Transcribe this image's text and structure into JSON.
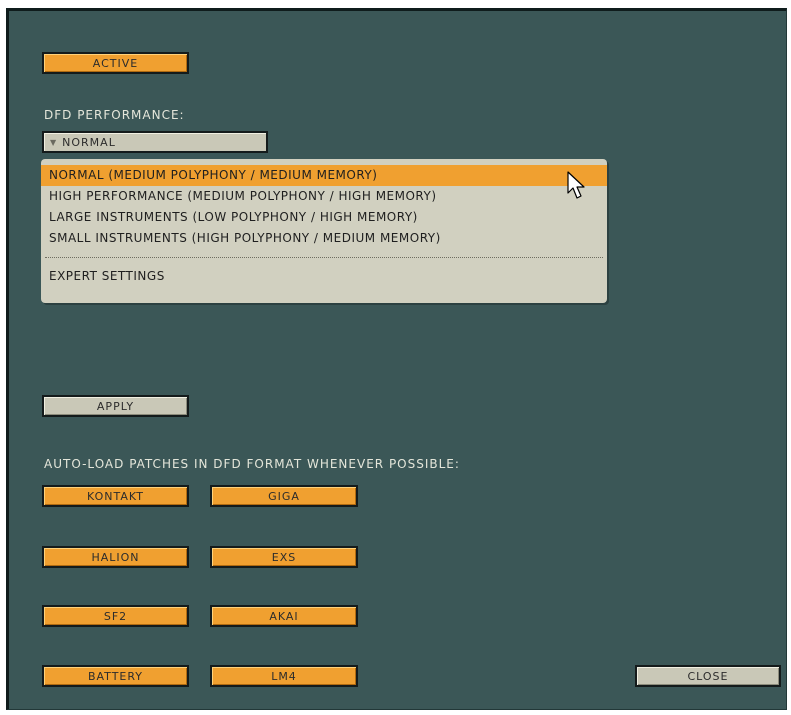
{
  "active_button": "ACTIVE",
  "dfd_performance": {
    "label": "DFD PERFORMANCE:",
    "selected": "NORMAL",
    "options": [
      "NORMAL (MEDIUM POLYPHONY / MEDIUM MEMORY)",
      "HIGH PERFORMANCE (MEDIUM POLYPHONY / HIGH MEMORY)",
      "LARGE INSTRUMENTS (LOW POLYPHONY / HIGH MEMORY)",
      "SMALL INSTRUMENTS (HIGH POLYPHONY / MEDIUM MEMORY)"
    ],
    "expert": "EXPERT SETTINGS"
  },
  "apply_button": "APPLY",
  "autoload": {
    "label": "AUTO-LOAD PATCHES IN DFD FORMAT WHENEVER POSSIBLE:",
    "buttons": [
      "KONTAKT",
      "GIGA",
      "HALION",
      "EXS",
      "SF2",
      "AKAI",
      "BATTERY",
      "LM4"
    ]
  },
  "close_button": "CLOSE",
  "colors": {
    "panel": "#3b5757",
    "orange": "#f0a030",
    "grey_button": "#c9c8b7",
    "dropdown": "#d1d0c0",
    "label_text": "#e4e6da"
  },
  "icons": {
    "dropdown_arrow": "triangle-down-icon",
    "mouse_pointer": "arrow-cursor-icon"
  }
}
